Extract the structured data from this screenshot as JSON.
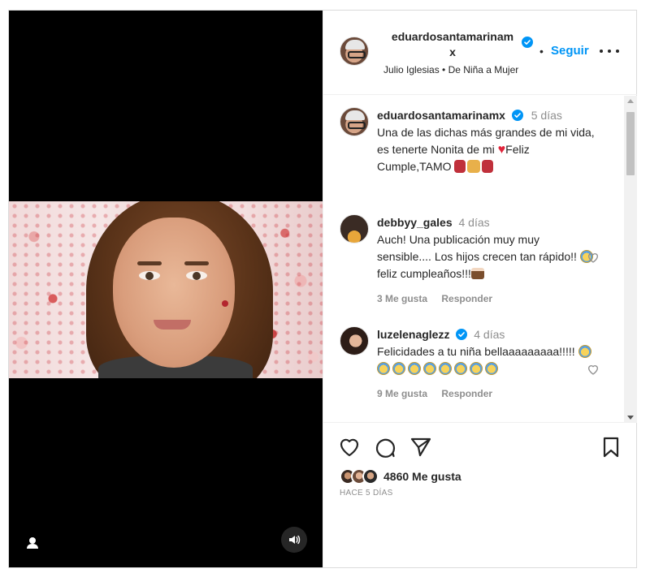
{
  "post": {
    "author": "eduardosantamarinamx",
    "author_line1": "eduardosantamarinam",
    "author_line2": "x",
    "follow_label": "Seguir",
    "separator": "•",
    "audio": "Julio Iglesias • De Niña a Mujer",
    "likes": "4860 Me gusta",
    "posted": "HACE 5 DÍAS"
  },
  "caption": {
    "username": "eduardosantamarinamx",
    "time": "5 días",
    "text_prefix": "Una de las dichas más grandes de mi vida, es tenerte Nonita de mi ",
    "text_suffix": "Feliz Cumple,TAMO"
  },
  "comments": [
    {
      "username": "debbyy_gales",
      "time": "4 días",
      "text_prefix": "Auch! Una publicación muy muy sensible.... Los hijos crecen tan rápido!! ",
      "text_suffix": " feliz cumpleaños!!!",
      "likes": "3 Me gusta",
      "reply": "Responder"
    },
    {
      "username": "luzelenaglezz",
      "time": "4 días",
      "text": "Felicidades a tu niña bellaaaaaaaaa!!!!! ",
      "likes": "9 Me gusta",
      "reply": "Responder"
    }
  ],
  "icons": {
    "like": "heart-icon",
    "comment": "comment-icon",
    "share": "share-icon",
    "save": "bookmark-icon",
    "more": "more-icon",
    "verified": "verified-badge-icon",
    "sound": "speaker-icon",
    "user_tag": "user-tag-icon"
  },
  "colors": {
    "accent": "#0095f6",
    "text": "#262626",
    "muted": "#8e8e8e",
    "heart": "#e0243b"
  }
}
